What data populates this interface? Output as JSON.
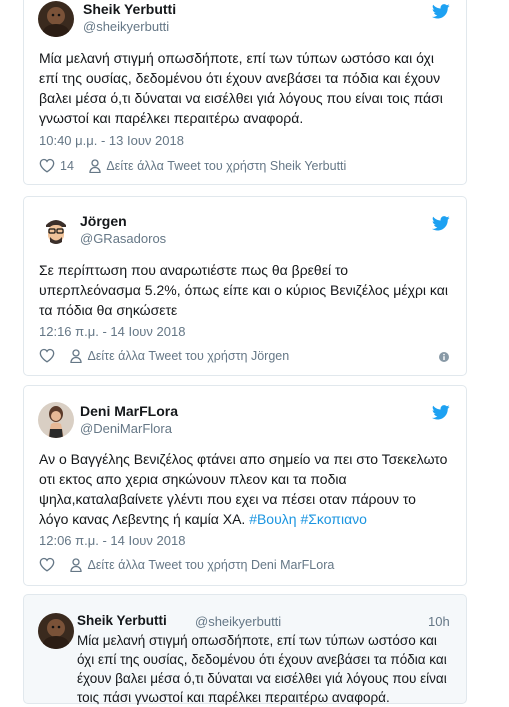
{
  "tweets": [
    {
      "name": "Sheik Yerbutti",
      "handle": "@sheikyerbutti",
      "text": "Μία μελανή στιγμή οπωσδήποτε, επί των τύπων ωστόσο και όχι επί της ουσίας, δεδομένου ότι έχουν ανεβάσει τα πόδια και έχουν βαλει μέσα ό,τι δύναται να εισέλθει γιά λόγους που είναι τοις πάσι γνωστοί και παρέλκει περαιτέρω αναφορά.",
      "timestamp": "10:40 μ.μ. - 13 Ιουν 2018",
      "like_count": "14",
      "more_tweets": "Δείτε άλλα Tweet του χρήστη Sheik Yerbutti"
    },
    {
      "name": "Jörgen",
      "handle": "@GRasadoros",
      "text": "Σε περίπτωση που αναρωτιέστε πως θα βρεθεί το υπερπλεόνασμα 5.2%, όπως είπε και ο κύριος Βενιζέλος μέχρι και τα πόδια θα σηκώσετε",
      "timestamp": "12:16 π.μ. - 14 Ιουν 2018",
      "more_tweets": "Δείτε άλλα Tweet του χρήστη Jörgen"
    },
    {
      "name": "Deni MarFLora",
      "handle": "@DeniMarFlora",
      "text_main": "Αν ο Βαγγέλης Βενιζέλος φτάνει απο σημείο να πει στο Τσεκελωτο οτι εκτος απο χερια σηκώνουν πλεον και τα ποδια ψηλα,καταλαβαίνετε γλέντι που εχει να πέσει οταν πάρουν το λόγο κανας Λεβεντης ή καμία ΧΑ.",
      "hashtag_1": "#Βουλη",
      "hashtag_2": "#Σκοπιανο",
      "timestamp": "12:06 π.μ. - 14 Ιουν 2018",
      "more_tweets": "Δείτε άλλα Tweet του χρήστη Deni MarFLora"
    }
  ],
  "compact": {
    "name": "Sheik Yerbutti",
    "handle": "@sheikyerbutti",
    "time": "10h",
    "text": "Μία μελανή στιγμή οπωσδήποτε, επί των τύπων ωστόσο και όχι επί της ουσίας, δεδομένου ότι έχουν ανεβάσει τα πόδια και έχουν βαλει μέσα ό,τι δύναται να εισέλθει γιά λόγους που είναι τοις πάσι γνωστοί και παρέλκει περαιτέρω αναφορά."
  },
  "colors": {
    "twitter_blue": "#1da1f2",
    "link_blue": "#1b95e0",
    "secondary_text": "#657786",
    "border": "#e1e8ed"
  },
  "icons": [
    "twitter-bird-icon",
    "heart-icon",
    "person-icon",
    "info-icon"
  ]
}
